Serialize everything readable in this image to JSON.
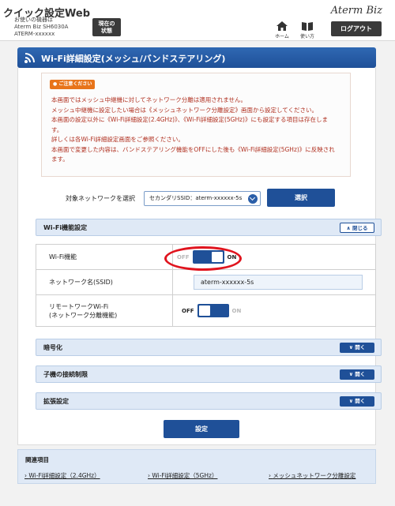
{
  "header": {
    "app_title": "クイック設定Web",
    "device_label": "お使いの機器は",
    "device_model": "Aterm Biz SH6030A",
    "device_name": "ATERM-xxxxxx",
    "status_button_line1": "現在の",
    "status_button_line2": "状態",
    "brand": "Aterm Biz",
    "home_label": "ホーム",
    "help_label": "使い方",
    "logout_label": "ログアウト"
  },
  "page": {
    "title": "Wi-Fi詳細設定(メッシュ/バンドステアリング)"
  },
  "notice": {
    "badge": "ご注意ください",
    "lines": [
      "本画面ではメッシュ中継機に対してネットワーク分離は適用されません。",
      "メッシュ中継機に設定したい場合は《メッシュネットワーク分離設定》画面から設定してください。",
      "本画面の設定以外に《Wi-Fi詳細設定(2.4GHz)》、《Wi-Fi詳細設定(5GHz)》にも設定する項目は存在しま",
      "す。",
      "詳しくは各Wi-Fi詳細設定画面をご参照ください。",
      "本画面で変更した内容は、バンドステアリング機能をOFFにした後も《Wi-Fi詳細設定(5GHz)》に反映され",
      "ます。"
    ]
  },
  "network_select": {
    "label": "対象ネットワークを選択",
    "value": "セカンダリSSID：aterm-xxxxxx-5s",
    "button": "選択"
  },
  "wifi_function": {
    "section_title": "Wi-Fi機能設定",
    "collapse_label": "閉じる",
    "rows": {
      "wifi": {
        "label": "Wi-Fi機能",
        "off": "OFF",
        "on": "ON",
        "state": "on"
      },
      "ssid": {
        "label": "ネットワーク名(SSID)",
        "value": "aterm-xxxxxx-5s"
      },
      "remote": {
        "label_line1": "リモートワークWi-Fi",
        "label_line2": "(ネットワーク分離機能)",
        "off": "OFF",
        "on": "ON",
        "state": "off"
      }
    }
  },
  "sections": {
    "encryption": {
      "title": "暗号化",
      "expand_label": "開く"
    },
    "access_limit": {
      "title": "子機の接続制限",
      "expand_label": "開く"
    },
    "extended": {
      "title": "拡張設定",
      "expand_label": "開く"
    }
  },
  "apply_button": "設定",
  "related": {
    "title": "関連項目",
    "links": [
      "Wi-Fi詳細設定（2.4GHz）",
      "Wi-Fi詳細設定（5GHz）",
      "メッシュネットワーク分離設定"
    ]
  },
  "colors": {
    "primary": "#1f5098",
    "section_bg": "#dfe9f6",
    "notice_text": "#b03020",
    "notice_badge": "#e8741a",
    "highlight": "#e0141e"
  }
}
